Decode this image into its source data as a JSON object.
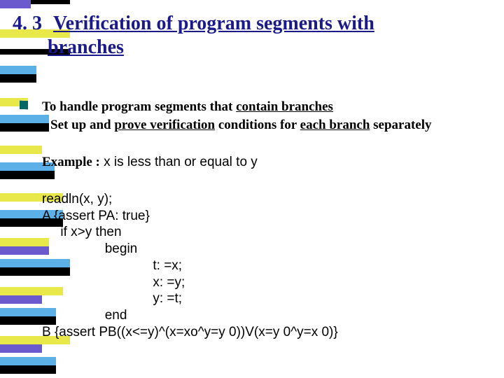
{
  "title": {
    "number": "4. 3",
    "line1": "Verification of program segments with",
    "line2": "branches"
  },
  "bullets": {
    "lead": "To handle program segments that ",
    "lead_u": "contain branches",
    "sub_a": "Set up and ",
    "sub_b": "prove verification",
    "sub_c": " conditions for ",
    "sub_d": "each branch",
    "sub_e": " separately"
  },
  "example": {
    "label": "Example :",
    "text": " x is less than or equal to y"
  },
  "code": {
    "l1": "readln(x, y);",
    "l2": "A {assert PA: true}",
    "l3": "     if x>y then",
    "l4": "                 begin",
    "l5": "                              t: =x;",
    "l6": "                              x: =y;",
    "l7": "                              y: =t;",
    "l8": "                 end",
    "l9": "B {assert PB((x<=y)^(x=xo^y=y 0))V(x=y 0^y=x 0)}"
  }
}
